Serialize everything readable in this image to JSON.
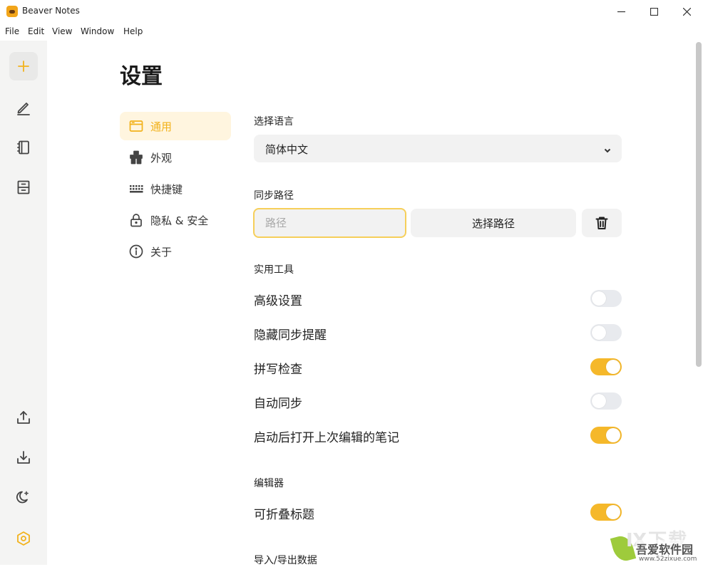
{
  "window": {
    "title": "Beaver Notes"
  },
  "menu": [
    "File",
    "Edit",
    "View",
    "Window",
    "Help"
  ],
  "sidebar": {
    "icons": [
      "plus-icon",
      "pencil-icon",
      "notebook-icon",
      "archive-icon",
      "upload-icon",
      "download-icon",
      "moon-icon",
      "settings-hex-icon"
    ],
    "accent": "#f2b21c"
  },
  "page": {
    "title": "设置"
  },
  "nav": [
    {
      "label": "通用",
      "icon": "window-icon",
      "active": true
    },
    {
      "label": "外观",
      "icon": "paint-bucket-icon",
      "active": false
    },
    {
      "label": "快捷键",
      "icon": "keyboard-icon",
      "active": false
    },
    {
      "label": "隐私 & 安全",
      "icon": "lock-icon",
      "active": false
    },
    {
      "label": "关于",
      "icon": "info-icon",
      "active": false
    }
  ],
  "language": {
    "label": "选择语言",
    "value": "简体中文"
  },
  "sync": {
    "label": "同步路径",
    "placeholder": "路径",
    "choose_label": "选择路径"
  },
  "tools": {
    "label": "实用工具",
    "items": [
      {
        "label": "高级设置",
        "on": false
      },
      {
        "label": "隐藏同步提醒",
        "on": false
      },
      {
        "label": "拼写检查",
        "on": true
      },
      {
        "label": "自动同步",
        "on": false
      },
      {
        "label": "启动后打开上次编辑的笔记",
        "on": true
      }
    ]
  },
  "editor": {
    "label": "编辑器",
    "items": [
      {
        "label": "可折叠标题",
        "on": true
      }
    ]
  },
  "import_export": {
    "label": "导入/导出数据"
  },
  "watermark": {
    "big": "Ⅸ下载",
    "text": "吾爱软件园",
    "url": "www.52zixue.com"
  }
}
